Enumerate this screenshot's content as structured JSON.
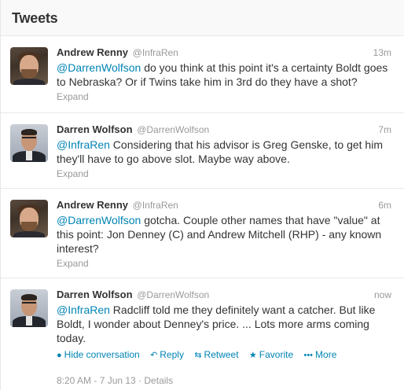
{
  "header": {
    "title": "Tweets"
  },
  "tweets": [
    {
      "fullname": "Andrew Renny",
      "username": "@InfraRen",
      "time": "13m",
      "mention": "@DarrenWolfson",
      "text": " do you think at this point it's a certainty Boldt goes to Nebraska? Or if Twins take him in 3rd do they have a shot?",
      "expand": "Expand",
      "avatar": "andrew-avatar"
    },
    {
      "fullname": "Darren Wolfson",
      "username": "@DarrenWolfson",
      "time": "7m",
      "mention": "@InfraRen",
      "text": " Considering that his advisor is Greg Genske, to get him they'll have to go above slot. Maybe way above.",
      "expand": "Expand",
      "avatar": "darren-avatar"
    },
    {
      "fullname": "Andrew Renny",
      "username": "@InfraRen",
      "time": "6m",
      "mention": "@DarrenWolfson",
      "text": " gotcha. Couple other names that have \"value\" at this point: Jon Denney (C) and Andrew Mitchell (RHP) - any known interest?",
      "expand": "Expand",
      "avatar": "andrew-avatar"
    },
    {
      "fullname": "Darren Wolfson",
      "username": "@DarrenWolfson",
      "time": "now",
      "mention": "@InfraRen",
      "text": " Radcliff told me they definitely want a catcher. But like Boldt, I wonder about Denney's price. ... Lots more arms coming today.",
      "avatar": "darren-avatar",
      "actions": {
        "hide": "Hide conversation",
        "reply": "Reply",
        "retweet": "Retweet",
        "favorite": "Favorite",
        "more": "More"
      },
      "meta": "8:20 AM - 7 Jun 13 · Details"
    }
  ],
  "colors": {
    "link": "#0084b4",
    "muted": "#999999",
    "text": "#333333"
  }
}
